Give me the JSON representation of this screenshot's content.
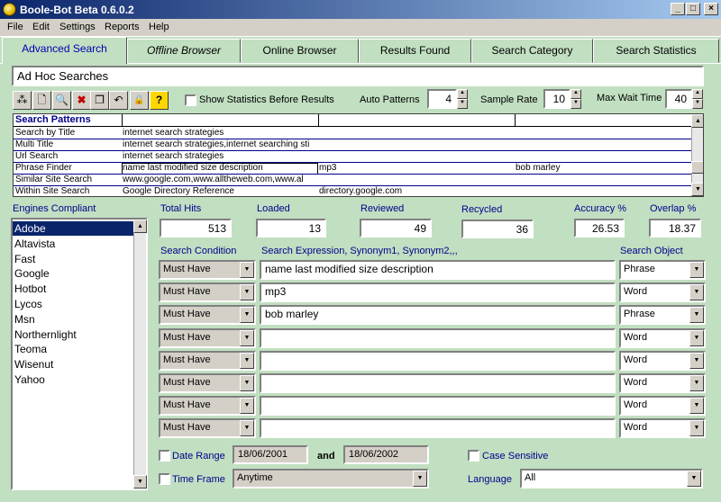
{
  "window": {
    "title": "Boole-Bot Beta 0.6.0.2",
    "btn_min": "_",
    "btn_max": "□",
    "btn_close": "×"
  },
  "menu": [
    "File",
    "Edit",
    "Settings",
    "Reports",
    "Help"
  ],
  "tabs": [
    "Advanced Search",
    "Offline Browser",
    "Online Browser",
    "Results Found",
    "Search Category",
    "Search Statistics"
  ],
  "query_name": "Ad Hoc Searches",
  "toolbar": {
    "icons": [
      "pattern-icon",
      "new-icon",
      "search-icon",
      "delete-icon",
      "copy-icon",
      "undo-icon",
      "lock-icon",
      "help-icon"
    ],
    "glyphs": [
      "⁂",
      "🗋",
      "🔍",
      "✖",
      "❐",
      "↶",
      "🔒",
      "?"
    ],
    "show_stats_label": "Show Statistics Before Results",
    "auto_patterns_label": "Auto Patterns",
    "auto_patterns": "4",
    "sample_rate_label": "Sample Rate",
    "sample_rate": "10",
    "max_wait_label": "Max Wait Time",
    "max_wait": "40"
  },
  "patterns": {
    "header": "Search Patterns",
    "rows": [
      [
        "Search by Title",
        "internet search strategies",
        "",
        ""
      ],
      [
        "Multi Title",
        "internet search strategies,internet searching sti",
        "",
        ""
      ],
      [
        "Url Search",
        "internet search strategies",
        "",
        ""
      ],
      [
        "Phrase Finder",
        "name last modified size description",
        "mp3",
        "bob marley"
      ],
      [
        "Similar Site Search",
        "www.google.com,www.alltheweb.com,www.al",
        "",
        ""
      ],
      [
        "Within Site Search",
        "Google Directory Reference",
        "directory.google.com",
        ""
      ]
    ]
  },
  "engines_label": "Engines Compliant",
  "engines": [
    "Adobe",
    "Altavista",
    "Fast",
    "Google",
    "Hotbot",
    "Lycos",
    "Msn",
    "Northernlight",
    "Teoma",
    "Wisenut",
    "Yahoo"
  ],
  "stats": {
    "total_hits_label": "Total Hits",
    "total_hits": "513",
    "loaded_label": "Loaded",
    "loaded": "13",
    "reviewed_label": "Reviewed",
    "reviewed": "49",
    "recycled_label": "Recycled",
    "recycled": "36",
    "accuracy_label": "Accuracy %",
    "accuracy": "26.53",
    "overlap_label": "Overlap %",
    "overlap": "18.37"
  },
  "conditions": {
    "condition_header": "Search Condition",
    "expression_header": "Search Expression, Synonym1, Synonym2,,,",
    "object_header": "Search Object",
    "rows": [
      {
        "condition": "Must Have",
        "expression": "name last modified size description",
        "object": "Phrase"
      },
      {
        "condition": "Must Have",
        "expression": "mp3",
        "object": "Word"
      },
      {
        "condition": "Must Have",
        "expression": "bob marley",
        "object": "Phrase"
      },
      {
        "condition": "Must Have",
        "expression": "",
        "object": "Word"
      },
      {
        "condition": "Must Have",
        "expression": "",
        "object": "Word"
      },
      {
        "condition": "Must Have",
        "expression": "",
        "object": "Word"
      },
      {
        "condition": "Must Have",
        "expression": "",
        "object": "Word"
      },
      {
        "condition": "Must Have",
        "expression": "",
        "object": "Word"
      }
    ]
  },
  "date_range": {
    "label": "Date Range",
    "from": "18/06/2001",
    "and": "and",
    "to": "18/06/2002"
  },
  "time_frame": {
    "label": "Time Frame",
    "value": "Anytime"
  },
  "case_sensitive_label": "Case Sensitive",
  "language": {
    "label": "Language",
    "value": "All"
  },
  "colors": {
    "panel_green": "#c1dfc1",
    "title_blue": "#0a246a",
    "selection": "#0a246a"
  }
}
